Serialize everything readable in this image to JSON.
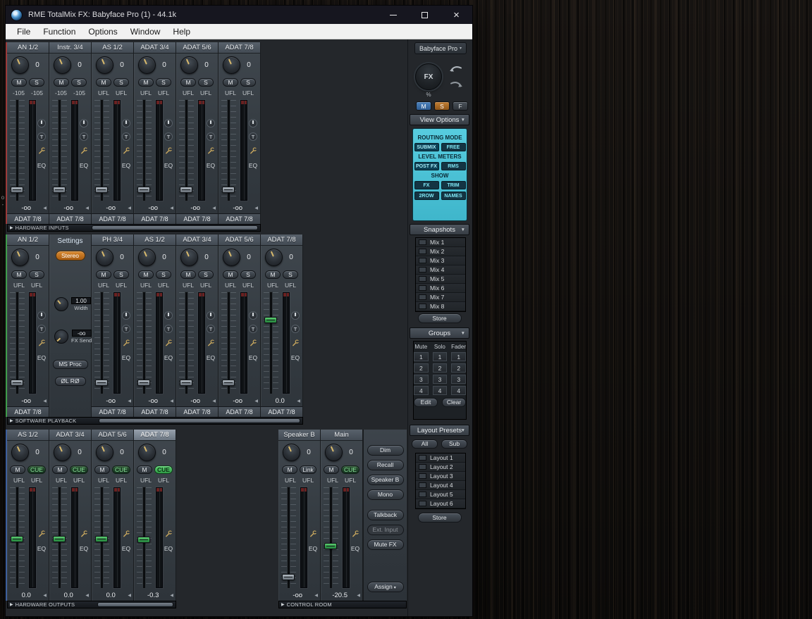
{
  "window": {
    "title": "RME TotalMix FX: Babyface Pro (1) - 44.1k",
    "menus": [
      "File",
      "Function",
      "Options",
      "Window",
      "Help"
    ]
  },
  "icons": {
    "dropdown": "▼",
    "dropdown_small": "▾",
    "collapse_left": "◀",
    "row_arrow": "▶",
    "close": "×"
  },
  "strip_labels": {
    "trim": "T",
    "eq": "EQ"
  },
  "desktop": {
    "fragments": [
      "o",
      "-"
    ]
  },
  "rows": {
    "inputs": {
      "bar_label": "HARDWARE INPUTS",
      "channels": [
        {
          "name": "AN 1/2",
          "knob": "0",
          "buttons": [
            {
              "label": "M",
              "name": "mute"
            },
            {
              "label": "S",
              "name": "solo"
            }
          ],
          "levels": [
            "-105",
            "-105"
          ],
          "value": "-oo",
          "target": "ADAT 7/8",
          "fader_pct": 86,
          "green": false,
          "trim": true
        },
        {
          "name": "Instr. 3/4",
          "knob": "0",
          "buttons": [
            {
              "label": "M",
              "name": "mute"
            },
            {
              "label": "S",
              "name": "solo"
            }
          ],
          "levels": [
            "-105",
            "-105"
          ],
          "value": "-oo",
          "target": "ADAT 7/8",
          "fader_pct": 86,
          "green": false,
          "trim": true
        },
        {
          "name": "AS 1/2",
          "knob": "0",
          "buttons": [
            {
              "label": "M",
              "name": "mute"
            },
            {
              "label": "S",
              "name": "solo"
            }
          ],
          "levels": [
            "UFL",
            "UFL"
          ],
          "value": "-oo",
          "target": "ADAT 7/8",
          "fader_pct": 86,
          "green": false,
          "trim": true
        },
        {
          "name": "ADAT 3/4",
          "knob": "0",
          "buttons": [
            {
              "label": "M",
              "name": "mute"
            },
            {
              "label": "S",
              "name": "solo"
            }
          ],
          "levels": [
            "UFL",
            "UFL"
          ],
          "value": "-oo",
          "target": "ADAT 7/8",
          "fader_pct": 86,
          "green": false,
          "trim": true
        },
        {
          "name": "ADAT 5/6",
          "knob": "0",
          "buttons": [
            {
              "label": "M",
              "name": "mute"
            },
            {
              "label": "S",
              "name": "solo"
            }
          ],
          "levels": [
            "UFL",
            "UFL"
          ],
          "value": "-oo",
          "target": "ADAT 7/8",
          "fader_pct": 86,
          "green": false,
          "trim": true
        },
        {
          "name": "ADAT 7/8",
          "knob": "0",
          "buttons": [
            {
              "label": "M",
              "name": "mute"
            },
            {
              "label": "S",
              "name": "solo"
            }
          ],
          "levels": [
            "UFL",
            "UFL"
          ],
          "value": "-oo",
          "target": "ADAT 7/8",
          "fader_pct": 86,
          "green": false,
          "trim": true
        }
      ]
    },
    "playback": {
      "bar_label": "SOFTWARE PLAYBACK",
      "channels": [
        {
          "name": "AN 1/2",
          "knob": "0",
          "buttons": [
            {
              "label": "M",
              "name": "mute"
            },
            {
              "label": "S",
              "name": "solo"
            }
          ],
          "levels": [
            "UFL",
            "UFL"
          ],
          "value": "-oo",
          "target": "ADAT 7/8",
          "fader_pct": 86,
          "green": false,
          "trim": true
        },
        {
          "type": "settings"
        },
        {
          "name": "PH 3/4",
          "knob": "0",
          "buttons": [
            {
              "label": "M",
              "name": "mute"
            },
            {
              "label": "S",
              "name": "solo"
            }
          ],
          "levels": [
            "UFL",
            "UFL"
          ],
          "value": "-oo",
          "target": "ADAT 7/8",
          "fader_pct": 86,
          "green": false,
          "trim": true
        },
        {
          "name": "AS 1/2",
          "knob": "0",
          "buttons": [
            {
              "label": "M",
              "name": "mute"
            },
            {
              "label": "S",
              "name": "solo"
            }
          ],
          "levels": [
            "UFL",
            "UFL"
          ],
          "value": "-oo",
          "target": "ADAT 7/8",
          "fader_pct": 86,
          "green": false,
          "trim": true
        },
        {
          "name": "ADAT 3/4",
          "knob": "0",
          "buttons": [
            {
              "label": "M",
              "name": "mute"
            },
            {
              "label": "S",
              "name": "solo"
            }
          ],
          "levels": [
            "UFL",
            "UFL"
          ],
          "value": "-oo",
          "target": "ADAT 7/8",
          "fader_pct": 86,
          "green": false,
          "trim": true
        },
        {
          "name": "ADAT 5/6",
          "knob": "0",
          "buttons": [
            {
              "label": "M",
              "name": "mute"
            },
            {
              "label": "S",
              "name": "solo"
            }
          ],
          "levels": [
            "UFL",
            "UFL"
          ],
          "value": "-oo",
          "target": "ADAT 7/8",
          "fader_pct": 86,
          "green": false,
          "trim": true
        },
        {
          "name": "ADAT 7/8",
          "knob": "0",
          "buttons": [
            {
              "label": "M",
              "name": "mute"
            },
            {
              "label": "S",
              "name": "solo"
            }
          ],
          "levels": [
            "UFL",
            "UFL"
          ],
          "value": "0.0",
          "target": "ADAT 7/8",
          "fader_pct": 24,
          "green": true,
          "trim": true
        }
      ]
    },
    "outputs": {
      "bar_label": "HARDWARE OUTPUTS",
      "channels": [
        {
          "name": "AS 1/2",
          "knob": "0",
          "buttons": [
            {
              "label": "M",
              "name": "mute"
            },
            {
              "label": "CUE",
              "name": "cue",
              "style": "cue"
            }
          ],
          "levels": [
            "UFL",
            "UFL"
          ],
          "value": "0.0",
          "fader_pct": 48,
          "green": true,
          "trim": false,
          "pan": false
        },
        {
          "name": "ADAT 3/4",
          "knob": "0",
          "buttons": [
            {
              "label": "M",
              "name": "mute"
            },
            {
              "label": "CUE",
              "name": "cue",
              "style": "cue"
            }
          ],
          "levels": [
            "UFL",
            "UFL"
          ],
          "value": "0.0",
          "fader_pct": 48,
          "green": true,
          "trim": false,
          "pan": false
        },
        {
          "name": "ADAT 5/6",
          "knob": "0",
          "buttons": [
            {
              "label": "M",
              "name": "mute"
            },
            {
              "label": "CUE",
              "name": "cue",
              "style": "cue"
            }
          ],
          "levels": [
            "UFL",
            "UFL"
          ],
          "value": "0.0",
          "fader_pct": 48,
          "green": true,
          "trim": false,
          "pan": false
        },
        {
          "name": "ADAT 7/8",
          "selected": true,
          "knob": "0",
          "buttons": [
            {
              "label": "M",
              "name": "mute"
            },
            {
              "label": "CUE",
              "name": "cue",
              "style": "cue-active"
            }
          ],
          "levels": [
            "UFL",
            "UFL"
          ],
          "value": "-0.3",
          "fader_pct": 49,
          "green": true,
          "trim": false,
          "pan": false
        }
      ]
    },
    "control_room": {
      "bar_label": "CONTROL ROOM",
      "channels": [
        {
          "name": "Speaker B",
          "knob": "0",
          "buttons": [
            {
              "label": "M",
              "name": "mute"
            },
            {
              "label": "Link",
              "name": "link"
            }
          ],
          "levels": [
            "UFL",
            "UFL"
          ],
          "value": "-oo",
          "fader_pct": 86,
          "green": false,
          "trim": false,
          "pan": false
        },
        {
          "name": "Main",
          "knob": "0",
          "buttons": [
            {
              "label": "M",
              "name": "mute"
            },
            {
              "label": "CUE",
              "name": "cue",
              "style": "cue"
            }
          ],
          "levels": [
            "UFL",
            "UFL"
          ],
          "value": "-20.5",
          "fader_pct": 55,
          "green": true,
          "trim": false,
          "pan": false
        }
      ],
      "buttons": [
        {
          "label": "Dim"
        },
        {
          "label": "Recall"
        },
        {
          "label": "Speaker B"
        },
        {
          "label": "Mono",
          "gap_after": true
        },
        {
          "label": "Talkback"
        },
        {
          "label": "Ext. Input",
          "disabled": true
        },
        {
          "label": "Mute FX"
        },
        {
          "label": "Assign",
          "arrow": true,
          "gap_before": true
        }
      ]
    }
  },
  "settings_panel": {
    "title": "Settings",
    "stereo": "Stereo",
    "width_value": "1.00",
    "width_label": "Width",
    "fx_send_value": "-oo",
    "fx_send_label": "FX Send",
    "ms_proc": "MS Proc",
    "phase": "ØL RØ"
  },
  "sidebar": {
    "device": "Babyface Pro",
    "fx_label": "FX",
    "percent": "%",
    "msf": [
      "M",
      "S",
      "F"
    ],
    "view_options": {
      "title": "View Options",
      "routing_mode_label": "ROUTING MODE",
      "submix": "SUBMIX",
      "free": "FREE",
      "level_meters_label": "LEVEL METERS",
      "post_fx": "POST FX",
      "rms": "RMS",
      "show_label": "SHOW",
      "fx": "FX",
      "trim": "TRIM",
      "two_row": "2ROW",
      "names": "NAMES"
    },
    "snapshots": {
      "title": "Snapshots",
      "items": [
        "Mix 1",
        "Mix 2",
        "Mix 3",
        "Mix 4",
        "Mix 5",
        "Mix 6",
        "Mix 7",
        "Mix 8"
      ],
      "store": "Store"
    },
    "groups": {
      "title": "Groups",
      "headers": [
        "Mute",
        "Solo",
        "Fader"
      ],
      "rows": [
        [
          "1",
          "1",
          "1"
        ],
        [
          "2",
          "2",
          "2"
        ],
        [
          "3",
          "3",
          "3"
        ],
        [
          "4",
          "4",
          "4"
        ]
      ],
      "edit": "Edit",
      "clear": "Clear"
    },
    "layouts": {
      "title": "Layout Presets",
      "all": "All",
      "sub": "Sub",
      "items": [
        "Layout 1",
        "Layout 2",
        "Layout 3",
        "Layout 4",
        "Layout 5",
        "Layout 6"
      ],
      "store": "Store"
    }
  }
}
